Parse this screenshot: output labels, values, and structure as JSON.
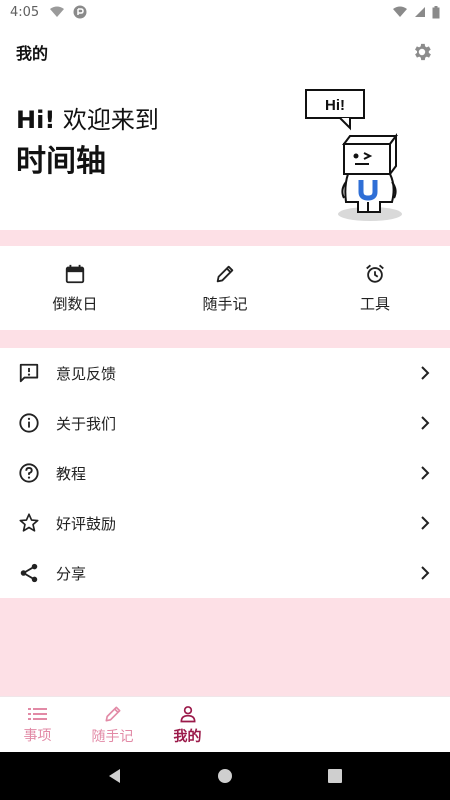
{
  "status_bar": {
    "time": "4:05"
  },
  "header": {
    "title": "我的"
  },
  "hero": {
    "greeting_hi": "Hi!",
    "greeting_rest": " 欢迎来到",
    "app_name": "时间轴",
    "mascot_bubble": "Hi!"
  },
  "quick_actions": [
    {
      "label": "倒数日",
      "icon": "calendar-icon"
    },
    {
      "label": "随手记",
      "icon": "pencil-icon"
    },
    {
      "label": "工具",
      "icon": "alarm-clock-icon"
    }
  ],
  "menu": [
    {
      "label": "意见反馈",
      "icon": "feedback-icon"
    },
    {
      "label": "关于我们",
      "icon": "info-icon"
    },
    {
      "label": "教程",
      "icon": "help-icon"
    },
    {
      "label": "好评鼓励",
      "icon": "star-icon"
    },
    {
      "label": "分享",
      "icon": "share-icon"
    }
  ],
  "bottom_nav": [
    {
      "label": "事项",
      "icon": "list-icon",
      "active": false
    },
    {
      "label": "随手记",
      "icon": "pencil-icon",
      "active": false
    },
    {
      "label": "我的",
      "icon": "person-icon",
      "active": true
    }
  ],
  "colors": {
    "pink_background": "#fde0e6",
    "nav_active": "#9b1a4a",
    "nav_inactive": "#e28aa6",
    "mascot_blue": "#2f6fd6"
  }
}
